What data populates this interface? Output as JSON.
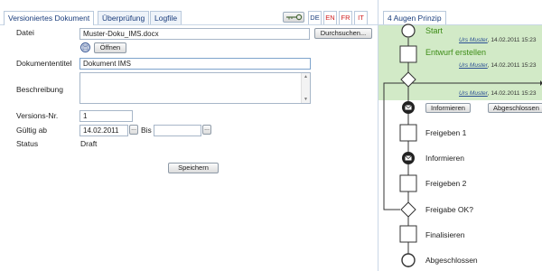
{
  "tabs": [
    {
      "label": "Versioniertes Dokument",
      "active": true
    },
    {
      "label": "Überprüfung",
      "active": false
    },
    {
      "label": "Logfile",
      "active": false
    }
  ],
  "languages": [
    {
      "code": "DE",
      "color": "#1a3d7c"
    },
    {
      "code": "EN",
      "color": "#d02020"
    },
    {
      "code": "FR",
      "color": "#d02020"
    },
    {
      "code": "IT",
      "color": "#d02020"
    }
  ],
  "key_icon": "key-icon",
  "form": {
    "datei_label": "Datei",
    "datei_value": "Muster-Doku_IMS.docx",
    "browse_label": "Durchsuchen...",
    "open_label": "Öffnen",
    "open_icon": "document-icon",
    "title_label": "Dokumententitel",
    "title_value": "Dokument IMS",
    "desc_label": "Beschreibung",
    "desc_value": "",
    "version_label": "Versions-Nr.",
    "version_value": "1",
    "valid_label": "Gültig ab",
    "valid_from": "14.02.2011",
    "to_label": "Bis",
    "valid_to": "",
    "date_button": "...",
    "status_label": "Status",
    "status_value": "Draft",
    "save_label": "Speichern"
  },
  "workflow": {
    "tab_label": "4 Augen Prinzip",
    "active_color": "#d2eac7",
    "steps": {
      "start": "Start",
      "entwurf": "Entwurf erstellen",
      "freigeben1": "Freigeben 1",
      "informieren": "Informieren",
      "freigeben2": "Freigeben 2",
      "freigabe_ok": "Freigabe OK?",
      "finalisieren": "Finalisieren",
      "abgeschlossen": "Abgeschlossen"
    },
    "meta": [
      {
        "user": "Urs Muster",
        "datetime": ", 14.02.2011 15:23"
      },
      {
        "user": "Urs Muster",
        "datetime": ", 14.02.2011 15:23"
      },
      {
        "user": "Urs Muster",
        "datetime": ", 14.02.2011 15:23"
      }
    ],
    "inform_button": "Informieren",
    "done_button": "Abgeschlossen",
    "mail_icon": "envelope-icon"
  }
}
